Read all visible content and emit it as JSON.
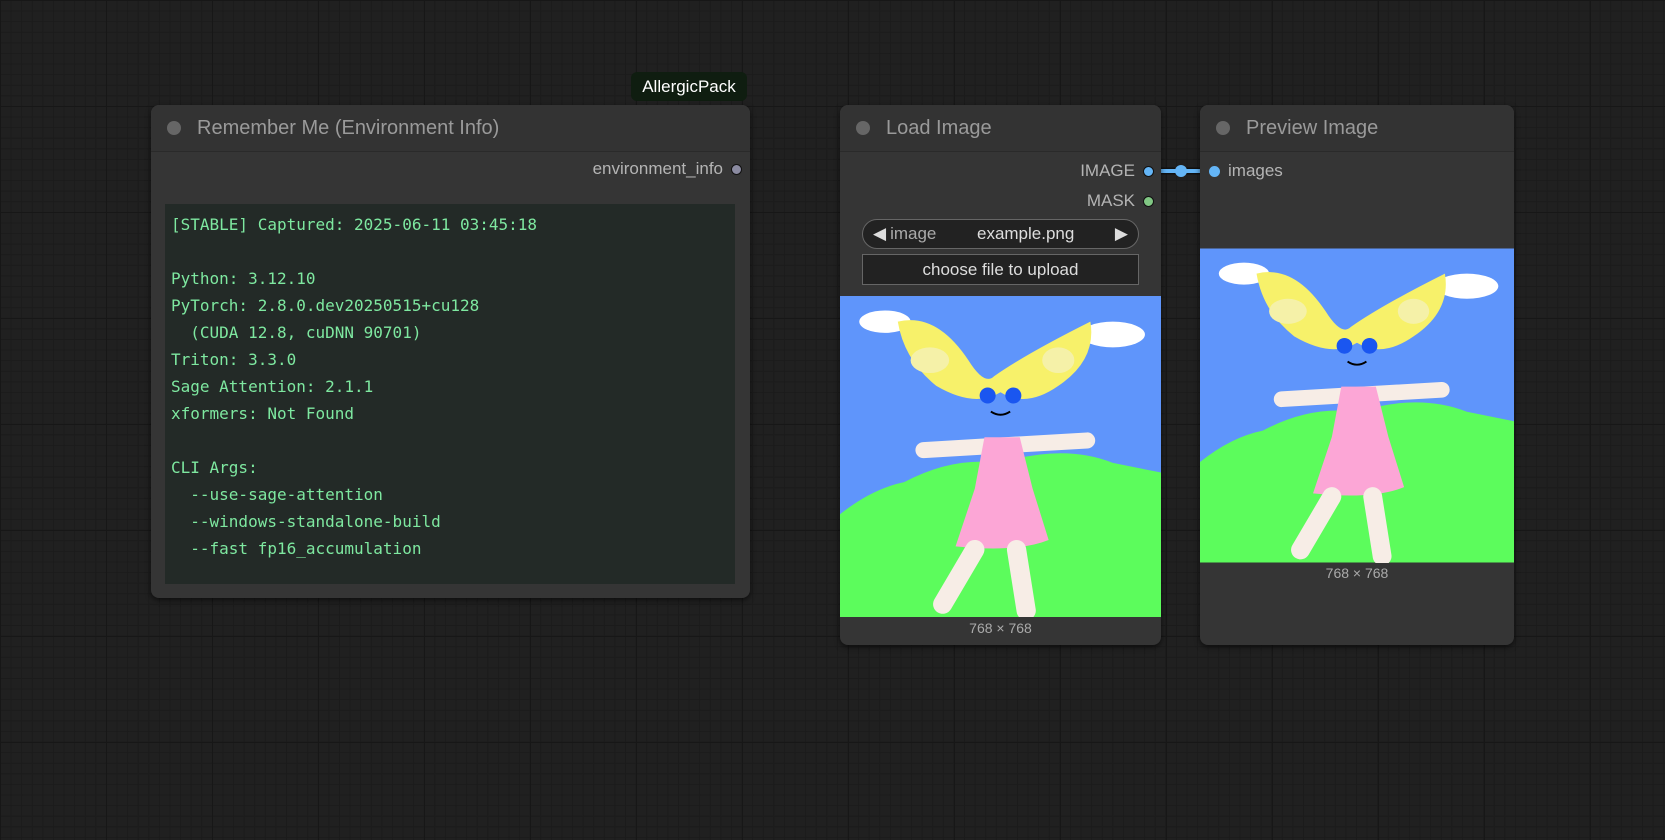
{
  "badge": "AllergicPack",
  "env_node": {
    "title": "Remember Me (Environment Info)",
    "output": "environment_info",
    "lines": [
      "[STABLE] Captured: 2025-06-11 03:45:18",
      "",
      "Python: 3.12.10",
      "PyTorch: 2.8.0.dev20250515+cu128",
      "  (CUDA 12.8, cuDNN 90701)",
      "Triton: 3.3.0",
      "Sage Attention: 2.1.1",
      "xformers: Not Found",
      "",
      "CLI Args:",
      "  --use-sage-attention",
      "  --windows-standalone-build",
      "  --fast fp16_accumulation"
    ]
  },
  "load_node": {
    "title": "Load Image",
    "outputs": [
      "IMAGE",
      "MASK"
    ],
    "combo_label": "image",
    "combo_value": "example.png",
    "upload_label": "choose file to upload",
    "caption": "768 × 768"
  },
  "preview_node": {
    "title": "Preview Image",
    "input": "images",
    "caption": "768 × 768"
  },
  "colors": {
    "image_socket": "#64b5f6",
    "mask_socket": "#81c784",
    "string_socket": "#8a8aa0",
    "link": "#64b5f6"
  }
}
